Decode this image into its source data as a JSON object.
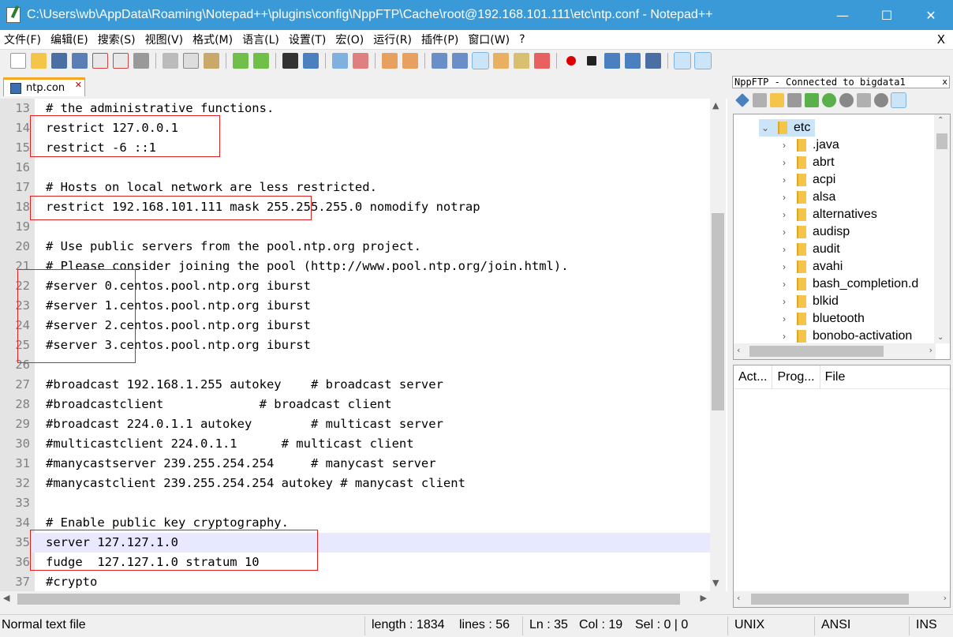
{
  "window": {
    "title": "C:\\Users\\wb\\AppData\\Roaming\\Notepad++\\plugins\\config\\NppFTP\\Cache\\root@192.168.101.111\\etc\\ntp.conf - Notepad++",
    "minimize": "—",
    "maximize": "☐",
    "close": "✕"
  },
  "menu": {
    "items": [
      "文件(F)",
      "编辑(E)",
      "搜索(S)",
      "视图(V)",
      "格式(M)",
      "语言(L)",
      "设置(T)",
      "宏(O)",
      "运行(R)",
      "插件(P)",
      "窗口(W)",
      "?"
    ],
    "close": "X"
  },
  "tab": {
    "label": "ntp.con",
    "close": "✕"
  },
  "editor": {
    "lines": [
      {
        "n": "13",
        "text": "# the administrative functions."
      },
      {
        "n": "14",
        "text": "restrict 127.0.0.1"
      },
      {
        "n": "15",
        "text": "restrict -6 ::1"
      },
      {
        "n": "16",
        "text": ""
      },
      {
        "n": "17",
        "text": "# Hosts on local network are less restricted."
      },
      {
        "n": "18",
        "text": "restrict 192.168.101.111 mask 255.255.255.0 nomodify notrap"
      },
      {
        "n": "19",
        "text": ""
      },
      {
        "n": "20",
        "text": "# Use public servers from the pool.ntp.org project."
      },
      {
        "n": "21",
        "text": "# Please consider joining the pool (http://www.pool.ntp.org/join.html)."
      },
      {
        "n": "22",
        "text": "#server 0.centos.pool.ntp.org iburst"
      },
      {
        "n": "23",
        "text": "#server 1.centos.pool.ntp.org iburst"
      },
      {
        "n": "24",
        "text": "#server 2.centos.pool.ntp.org iburst"
      },
      {
        "n": "25",
        "text": "#server 3.centos.pool.ntp.org iburst"
      },
      {
        "n": "26",
        "text": ""
      },
      {
        "n": "27",
        "text": "#broadcast 192.168.1.255 autokey    # broadcast server"
      },
      {
        "n": "28",
        "text": "#broadcastclient             # broadcast client"
      },
      {
        "n": "29",
        "text": "#broadcast 224.0.1.1 autokey        # multicast server"
      },
      {
        "n": "30",
        "text": "#multicastclient 224.0.1.1      # multicast client"
      },
      {
        "n": "31",
        "text": "#manycastserver 239.255.254.254     # manycast server"
      },
      {
        "n": "32",
        "text": "#manycastclient 239.255.254.254 autokey # manycast client"
      },
      {
        "n": "33",
        "text": ""
      },
      {
        "n": "34",
        "text": "# Enable public key cryptography."
      },
      {
        "n": "35",
        "text": "server 127.127.1.0"
      },
      {
        "n": "36",
        "text": "fudge  127.127.1.0 stratum 10"
      },
      {
        "n": "37",
        "text": "#crypto"
      }
    ],
    "current_line": "35"
  },
  "ftp": {
    "header": "NppFTP - Connected to bigdata1",
    "header_close": "x",
    "tree_root": "etc",
    "tree_items": [
      ".java",
      "abrt",
      "acpi",
      "alsa",
      "alternatives",
      "audisp",
      "audit",
      "avahi",
      "bash_completion.d",
      "blkid",
      "bluetooth",
      "bonobo-activation"
    ],
    "queue_columns": [
      "Act...",
      "Prog...",
      "File"
    ]
  },
  "status": {
    "file_type": "Normal text file",
    "length": "length : 1834",
    "lines": "lines : 56",
    "ln": "Ln : 35",
    "col": "Col : 19",
    "sel": "Sel : 0 | 0",
    "eol": "UNIX",
    "encoding": "ANSI",
    "mode": "INS"
  },
  "colors": {
    "titlebar": "#3a9ad8",
    "annotation_box": "#e02020",
    "current_line": "#e8e8ff",
    "tab_accent": "#f5a623"
  }
}
